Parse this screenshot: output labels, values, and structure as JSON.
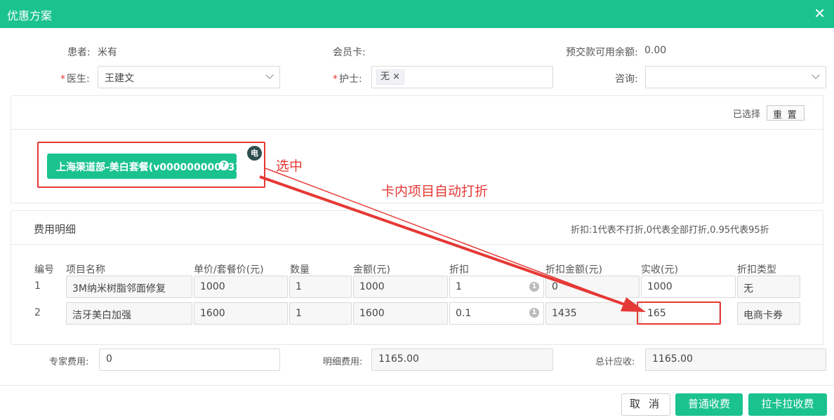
{
  "window": {
    "title": "优惠方案",
    "close_icon": "✕"
  },
  "patient": {
    "label": "患者:",
    "value": "米有"
  },
  "member_card": {
    "label": "会员卡:"
  },
  "prepaid": {
    "label": "预交款可用余额:",
    "value": "0.00"
  },
  "doctor": {
    "required_mark": "*",
    "label": "医生:",
    "value": "王建文"
  },
  "nurse": {
    "required_mark": "*",
    "label": "护士:",
    "tag": "无 ×"
  },
  "consult": {
    "label": "咨询:",
    "value": ""
  },
  "selection": {
    "selected_label": "已选择",
    "reset_label": "重 置"
  },
  "package": {
    "name": "上海渠道部-美白套餐(v00000000093)",
    "help_icon": "?",
    "badge": "电"
  },
  "annotations": {
    "selected": "选中",
    "auto_discount": "卡内项目自动打折"
  },
  "fees": {
    "title": "费用明细",
    "hint": "折扣:1代表不打折,0代表全部打折,0.95代表95折",
    "columns": [
      "编号",
      "项目名称",
      "单价/套餐价(元)",
      "数量",
      "金额(元)",
      "折扣",
      "折扣金额(元)",
      "实收(元)",
      "折扣类型"
    ],
    "rows": [
      {
        "no": "1",
        "name": "3M纳米树脂邻面修复",
        "price": "1000",
        "qty": "1",
        "amount": "1000",
        "discount": "1",
        "discount_amount": "0",
        "actual": "1000",
        "discount_type": "无"
      },
      {
        "no": "2",
        "name": "洁牙美白加强",
        "price": "1600",
        "qty": "1",
        "amount": "1600",
        "discount": "0.1",
        "discount_amount": "1435",
        "actual": "165",
        "discount_type": "电商卡券"
      }
    ],
    "info_icon": "1"
  },
  "totals": {
    "expert_label": "专家费用:",
    "expert_value": "0",
    "detail_label": "明细费用:",
    "detail_value": "1165.00",
    "total_label": "总计应收:",
    "total_value": "1165.00"
  },
  "buttons": {
    "cancel": "取 消",
    "normal_pay": "普通收费",
    "lakala_pay": "拉卡拉收费"
  },
  "colors": {
    "primary": "#1ac28e",
    "annotation_red": "#e53935"
  }
}
